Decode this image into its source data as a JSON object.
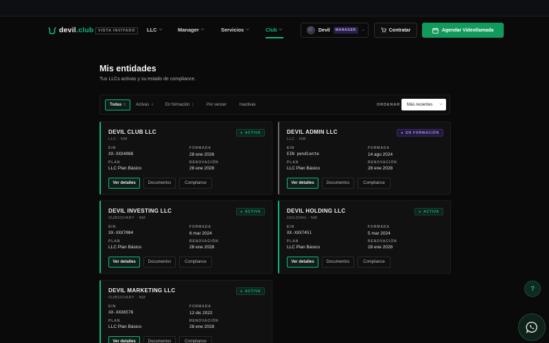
{
  "brand": {
    "name_main": "devil",
    "name_ext": ".club",
    "guest_badge": "VISTA INVITADO"
  },
  "nav": {
    "items": [
      {
        "label": "LLC",
        "chevron": "chevron-down-icon"
      },
      {
        "label": "Manager",
        "chevron": "chevron-down-icon"
      },
      {
        "label": "Servicios",
        "chevron": "chevron-down-icon"
      },
      {
        "label": "Club",
        "chevron": "chevron-down-icon",
        "active": true
      }
    ]
  },
  "user": {
    "name": "Devil",
    "role": "MANAGER"
  },
  "actions": {
    "contratar": "Contratar",
    "video": "Agendar Videollamada"
  },
  "page": {
    "title": "Mis entidades",
    "subtitle": "Tus LLCs activas y su estado de compliance."
  },
  "filters": {
    "tabs": [
      {
        "label": "Todas",
        "count": "5",
        "active": true
      },
      {
        "label": "Activas",
        "count": "4"
      },
      {
        "label": "En formación",
        "count": "1"
      },
      {
        "label": "Por vencer",
        "count": ""
      },
      {
        "label": "Inactivas",
        "count": ""
      }
    ],
    "sort_label": "ORDENAR",
    "sort_value": "Más recientes"
  },
  "field_labels": {
    "ein": "EIN",
    "formada": "FORMADA",
    "plan": "PLAN",
    "renovacion": "RENOVACIÓN"
  },
  "card_buttons": {
    "details": "Ver detalles",
    "docs": "Documentos",
    "compliance": "Compliance"
  },
  "entities": [
    {
      "name": "DEVIL CLUB LLC",
      "type": "LLC · NM",
      "status": "ACTIVA",
      "status_kind": "activa",
      "ein": "XX-XXX4088",
      "formada": "28 ene 2026",
      "plan": "LLC Plan Básico",
      "renovacion": "28 ene 2028"
    },
    {
      "name": "DEVIL ADMIN LLC",
      "type": "LLC · NM",
      "status": "EN FORMACIÓN",
      "status_kind": "formacion",
      "ein": "EIN pendiente",
      "formada": "14 ago 2024",
      "plan": "LLC Plan Básico",
      "renovacion": "28 ene 2028"
    },
    {
      "name": "DEVIL INVESTING LLC",
      "type": "SUBSIDIARY · NM",
      "status": "ACTIVA",
      "status_kind": "activa",
      "ein": "XX-XXX7084",
      "formada": "6 mar 2024",
      "plan": "LLC Plan Básico",
      "renovacion": "28 ene 2028"
    },
    {
      "name": "DEVIL HOLDING LLC",
      "type": "HOLDING · NM",
      "status": "ACTIVA",
      "status_kind": "activa",
      "ein": "XX-XXX7451",
      "formada": "5 mar 2024",
      "plan": "LLC Plan Básico",
      "renovacion": "28 ene 2028"
    },
    {
      "name": "DEVIL MARKETING LLC",
      "type": "SUBSIDIARY · NM",
      "status": "ACTIVA",
      "status_kind": "activa",
      "ein": "XX-XXX6578",
      "formada": "12 dic 2022",
      "plan": "LLC Plan Básico",
      "renovacion": "28 ene 2028"
    }
  ],
  "fabs": {
    "help": "?",
    "whatsapp": "whatsapp-icon"
  },
  "colors": {
    "accent": "#10b981",
    "background": "#0a0a0a",
    "formacion": "#b48cff"
  }
}
